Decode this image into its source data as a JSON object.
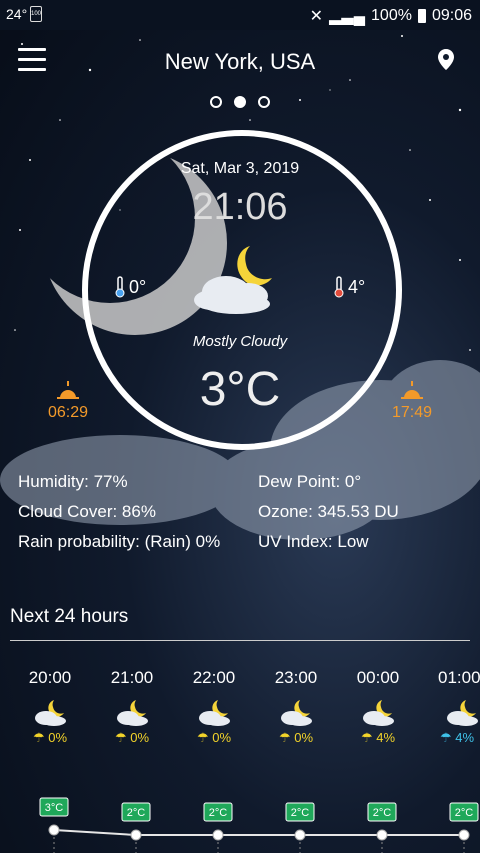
{
  "status_bar": {
    "left_temp": "24°",
    "battery": "100%",
    "time": "09:06"
  },
  "header": {
    "city": "New York, USA",
    "menu_icon": "hamburger-menu-icon",
    "location_icon": "location-pin-icon"
  },
  "page_dots": {
    "count": 3,
    "active": 1
  },
  "current": {
    "date": "Sat, Mar 3, 2019",
    "time": "21:06",
    "temp_min": "0°",
    "temp_max": "4°",
    "condition": "Mostly Cloudy",
    "temperature": "3°C",
    "icon": "cloudy-moon-icon"
  },
  "sun": {
    "sunrise": "06:29",
    "sunset": "17:49"
  },
  "details": {
    "humidity": "Humidity: 77%",
    "cloud_cover": "Cloud Cover: 86%",
    "rain_probability": "Rain probability: (Rain) 0%",
    "dew_point": "Dew Point: 0°",
    "ozone": "Ozone: 345.53 DU",
    "uv_index": "UV Index: Low"
  },
  "next24": {
    "title": "Next 24 hours",
    "hours": [
      {
        "time": "20:00",
        "rain": "0%",
        "temp": "3°C"
      },
      {
        "time": "21:00",
        "rain": "0%",
        "temp": "2°C"
      },
      {
        "time": "22:00",
        "rain": "0%",
        "temp": "2°C"
      },
      {
        "time": "23:00",
        "rain": "0%",
        "temp": "2°C"
      },
      {
        "time": "00:00",
        "rain": "4%",
        "temp": "2°C"
      },
      {
        "time": "01:00",
        "rain": "4%",
        "temp": "2°C"
      }
    ]
  },
  "colors": {
    "accent_orange": "#f39a2a",
    "badge_green": "#1fa85a",
    "rain_yellow": "#f2d32a",
    "rain_blue": "#3fc1e8"
  }
}
